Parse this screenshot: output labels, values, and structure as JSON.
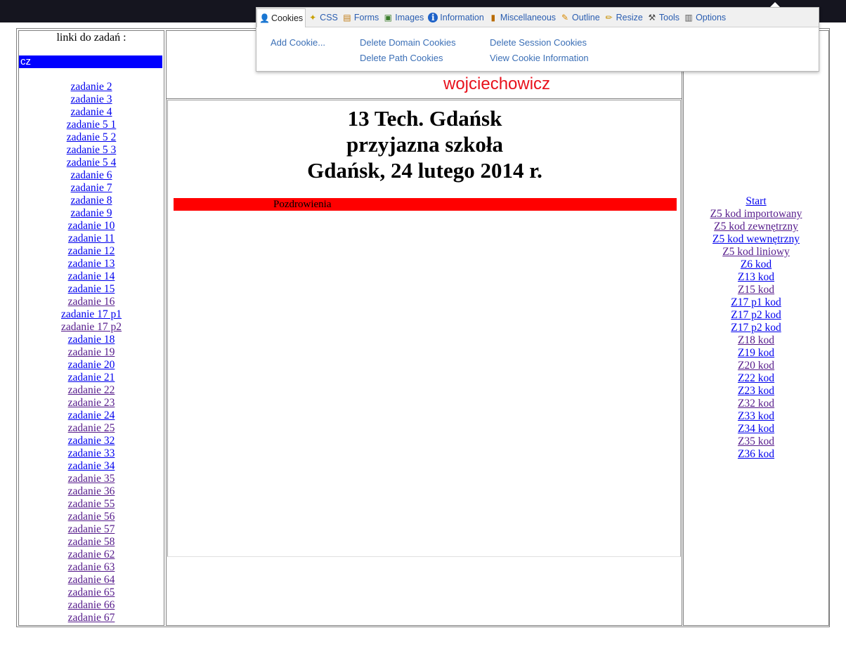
{
  "left_panel": {
    "heading": "linki do zadań :",
    "bar_text": "cz",
    "links": [
      {
        "label": "zadanie 2",
        "visited": false
      },
      {
        "label": "zadanie 3",
        "visited": false
      },
      {
        "label": "zadanie 4",
        "visited": false
      },
      {
        "label": "zadanie 5 1",
        "visited": false
      },
      {
        "label": "zadanie 5 2",
        "visited": false
      },
      {
        "label": "zadanie 5 3",
        "visited": false
      },
      {
        "label": "zadanie 5 4",
        "visited": false
      },
      {
        "label": "zadanie 6",
        "visited": false
      },
      {
        "label": "zadanie 7",
        "visited": false
      },
      {
        "label": "zadanie 8",
        "visited": false
      },
      {
        "label": "zadanie 9",
        "visited": false
      },
      {
        "label": "zadanie 10",
        "visited": false
      },
      {
        "label": "zadanie 11",
        "visited": false
      },
      {
        "label": "zadanie 12",
        "visited": false
      },
      {
        "label": "zadanie 13",
        "visited": false
      },
      {
        "label": "zadanie 14",
        "visited": false
      },
      {
        "label": "zadanie 15",
        "visited": false
      },
      {
        "label": "zadanie 16",
        "visited": true
      },
      {
        "label": "zadanie 17 p1",
        "visited": false
      },
      {
        "label": "zadanie 17 p2",
        "visited": true
      },
      {
        "label": "zadanie 18",
        "visited": false
      },
      {
        "label": "zadanie 19",
        "visited": true
      },
      {
        "label": "zadanie 20",
        "visited": false
      },
      {
        "label": "zadanie 21",
        "visited": false
      },
      {
        "label": "zadanie 22",
        "visited": true
      },
      {
        "label": "zadanie 23",
        "visited": true
      },
      {
        "label": "zadanie 24",
        "visited": false
      },
      {
        "label": "zadanie 25",
        "visited": true
      },
      {
        "label": "zadanie 32",
        "visited": false
      },
      {
        "label": "zadanie 33",
        "visited": false
      },
      {
        "label": "zadanie 34",
        "visited": false
      },
      {
        "label": "zadanie 35",
        "visited": true
      },
      {
        "label": "zadanie 36",
        "visited": true
      },
      {
        "label": "zadanie 55",
        "visited": true
      },
      {
        "label": "zadanie 56",
        "visited": true
      },
      {
        "label": "zadanie 57",
        "visited": true
      },
      {
        "label": "zadanie 58",
        "visited": true
      },
      {
        "label": "zadanie 62",
        "visited": true
      },
      {
        "label": "zadanie 63",
        "visited": true
      },
      {
        "label": "zadanie 64",
        "visited": true
      },
      {
        "label": "zadanie 65",
        "visited": true
      },
      {
        "label": "zadanie 66",
        "visited": true
      },
      {
        "label": "zadanie 67",
        "visited": true
      }
    ]
  },
  "banner_text": "wojciechowicz",
  "main": {
    "heading_lines": [
      "13 Tech. Gdańsk",
      "przyjazna szkoła",
      "Gdańsk, 24 lutego 2014 r."
    ],
    "red_bar_text": "Pozdrowienia"
  },
  "right_panel": {
    "links": [
      {
        "label": "Start",
        "visited": false
      },
      {
        "label": "Z5 kod importowany",
        "visited": true
      },
      {
        "label": "Z5 kod zewnętrzny",
        "visited": true
      },
      {
        "label": "Z5 kod wewnętrzny",
        "visited": false
      },
      {
        "label": "Z5 kod liniowy",
        "visited": true
      },
      {
        "label": "Z6 kod",
        "visited": false
      },
      {
        "label": "Z13 kod",
        "visited": false
      },
      {
        "label": "Z15 kod",
        "visited": true
      },
      {
        "label": "Z17 p1 kod",
        "visited": false
      },
      {
        "label": "Z17 p2 kod",
        "visited": false
      },
      {
        "label": "Z17 p2 kod",
        "visited": false
      },
      {
        "label": "Z18 kod",
        "visited": true
      },
      {
        "label": "Z19 kod",
        "visited": false
      },
      {
        "label": "Z20 kod",
        "visited": true
      },
      {
        "label": "Z22 kod",
        "visited": false
      },
      {
        "label": "Z23 kod",
        "visited": false
      },
      {
        "label": "Z32 kod",
        "visited": true
      },
      {
        "label": "Z33 kod",
        "visited": false
      },
      {
        "label": "Z34 kod",
        "visited": false
      },
      {
        "label": "Z35 kod",
        "visited": true
      },
      {
        "label": "Z36 kod",
        "visited": false
      }
    ]
  },
  "devtoolbar": {
    "tabs": [
      {
        "label": "Cookies",
        "icon": "user-icon",
        "active": true
      },
      {
        "label": "CSS",
        "icon": "magic-wand-icon",
        "active": false
      },
      {
        "label": "Forms",
        "icon": "clipboard-icon",
        "active": false
      },
      {
        "label": "Images",
        "icon": "image-icon",
        "active": false
      },
      {
        "label": "Information",
        "icon": "info-icon",
        "active": false
      },
      {
        "label": "Miscellaneous",
        "icon": "book-icon",
        "active": false
      },
      {
        "label": "Outline",
        "icon": "pencil-icon",
        "active": false
      },
      {
        "label": "Resize",
        "icon": "ruler-icon",
        "active": false
      },
      {
        "label": "Tools",
        "icon": "tools-icon",
        "active": false
      },
      {
        "label": "Options",
        "icon": "options-icon",
        "active": false
      }
    ],
    "menu": {
      "add_cookie": "Add Cookie...",
      "delete_domain_cookies": "Delete Domain Cookies",
      "delete_path_cookies": "Delete Path Cookies",
      "delete_session_cookies": "Delete Session Cookies",
      "view_cookie_information": "View Cookie Information"
    }
  },
  "colors": {
    "link": "#0000ee",
    "visited_link": "#551a8b",
    "banner": "#e8111c",
    "red_bar": "#ff0000",
    "blue_bar": "#0000ff",
    "toolbar_link": "#3b6fb6",
    "top_bar": "#15151f"
  }
}
